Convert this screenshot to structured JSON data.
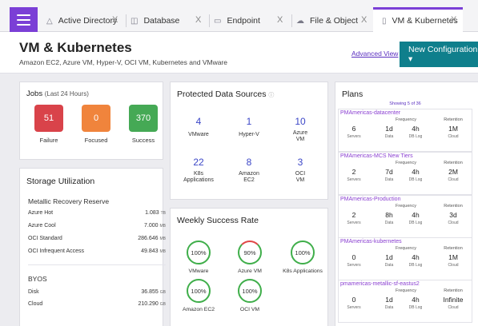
{
  "tabs": [
    {
      "label": "Active Directory",
      "icon": "triangle-icon",
      "close": "X"
    },
    {
      "label": "Database",
      "icon": "database-icon",
      "close": "X"
    },
    {
      "label": "Endpoint",
      "icon": "monitor-icon",
      "close": "X"
    },
    {
      "label": "File & Object",
      "icon": "cloud-icon",
      "close": "X"
    },
    {
      "label": "VM & Kubernetes",
      "icon": "server-icon",
      "close": "X"
    }
  ],
  "header": {
    "title": "VM & Kubernetes",
    "subtitle": "Amazon EC2, Azure VM, Hyper-V, OCI VM, Kubernetes and VMware",
    "advanced_view": "Advanced View",
    "new_config": "New Configuration ▾"
  },
  "jobs": {
    "title": "Jobs",
    "period": "(Last 24 Hours)",
    "items": [
      {
        "value": "51",
        "label": "Failure",
        "color": "#d9434a"
      },
      {
        "value": "0",
        "label": "Focused",
        "color": "#f0843c"
      },
      {
        "value": "370",
        "label": "Success",
        "color": "#45a955"
      }
    ]
  },
  "storage": {
    "title": "Storage Utilization",
    "groups": [
      {
        "heading": "Metallic Recovery Reserve",
        "rows": [
          {
            "name": "Azure Hot",
            "value": "1.083",
            "unit": "TB"
          },
          {
            "name": "Azure Cool",
            "value": "7.000",
            "unit": "MB"
          },
          {
            "name": "OCI Standard",
            "value": "286.646",
            "unit": "MB"
          },
          {
            "name": "OCI Infrequent Access",
            "value": "49.843",
            "unit": "MB"
          }
        ]
      },
      {
        "heading": "BYOS",
        "rows": [
          {
            "name": "Disk",
            "value": "36.855",
            "unit": "GB"
          },
          {
            "name": "Cloud",
            "value": "210.290",
            "unit": "GB"
          }
        ]
      }
    ]
  },
  "pds": {
    "title": "Protected Data Sources",
    "info_icon": "info-icon",
    "items": [
      {
        "value": "4",
        "label": "VMware"
      },
      {
        "value": "1",
        "label": "Hyper-V"
      },
      {
        "value": "10",
        "label": "Azure\nVM"
      },
      {
        "value": "22",
        "label": "K8s\nApplications"
      },
      {
        "value": "8",
        "label": "Amazon\nEC2"
      },
      {
        "value": "3",
        "label": "OCI\nVM"
      }
    ]
  },
  "wsr": {
    "title": "Weekly Success Rate",
    "items": [
      {
        "value": "100%",
        "label": "VMware",
        "fraction": 1.0
      },
      {
        "value": "90%",
        "label": "Azure VM",
        "fraction": 0.9
      },
      {
        "value": "100%",
        "label": "K8s Applications",
        "fraction": 1.0
      },
      {
        "value": "100%",
        "label": "Amazon EC2",
        "fraction": 1.0
      },
      {
        "value": "100%",
        "label": "OCI VM",
        "fraction": 1.0
      }
    ]
  },
  "plans": {
    "title": "Plans",
    "showing": "Showing 5 of 36",
    "freq_label": "Frequency",
    "ret_label": "Retention",
    "items": [
      {
        "name": "PMAmericas-datacenter",
        "servers": "6",
        "data": "1d",
        "dblog": "4h",
        "retention": "1M",
        "sl": "Servers",
        "dl": "Data",
        "dbl": "DB Log",
        "rl": "Cloud"
      },
      {
        "name": "PMAmericas-MCS New Tiers",
        "servers": "2",
        "data": "7d",
        "dblog": "4h",
        "retention": "2M",
        "sl": "Servers",
        "dl": "Data",
        "dbl": "DB Log",
        "rl": "Cloud"
      },
      {
        "name": "PMAmericas-Production",
        "servers": "2",
        "data": "8h",
        "dblog": "4h",
        "retention": "3d",
        "sl": "Servers",
        "dl": "Data",
        "dbl": "DB Log",
        "rl": "Cloud"
      },
      {
        "name": "PMAmericas-kubernetes",
        "servers": "0",
        "data": "1d",
        "dblog": "4h",
        "retention": "1M",
        "sl": "Servers",
        "dl": "Data",
        "dbl": "DB Log",
        "rl": "Cloud"
      },
      {
        "name": "pmamericas-metallic-sf-eastus2",
        "servers": "0",
        "data": "1d",
        "dblog": "4h",
        "retention": "Infinite",
        "sl": "Servers",
        "dl": "Data",
        "dbl": "DB Log",
        "rl": "Cloud"
      }
    ]
  }
}
